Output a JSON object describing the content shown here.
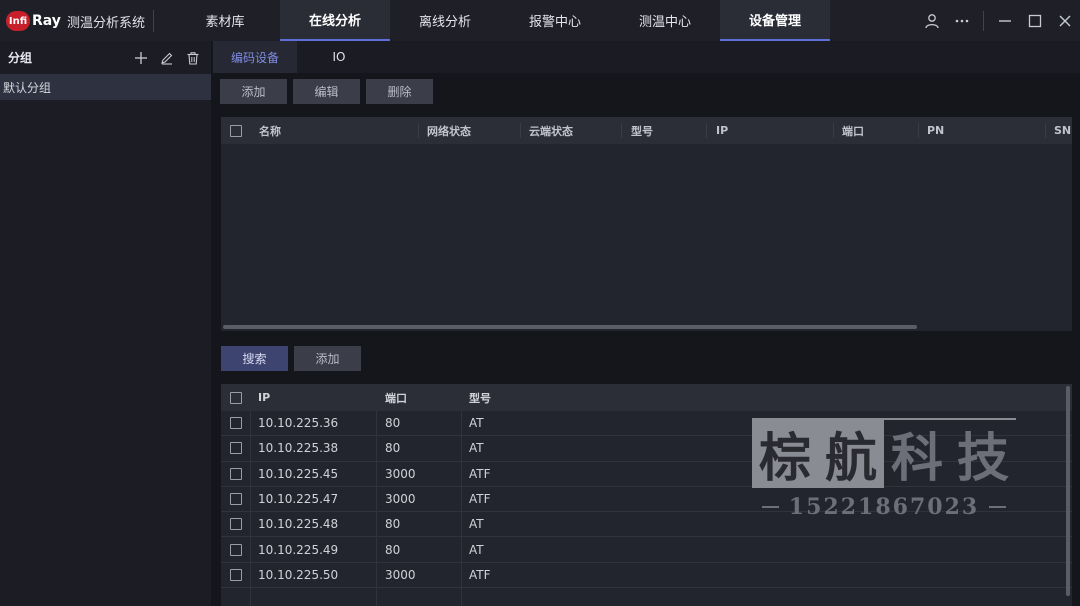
{
  "header": {
    "logo_mark": "Infi",
    "logo_text": "Ray",
    "app_name": "测温分析系统",
    "tabs": [
      {
        "label": "素材库",
        "active": false
      },
      {
        "label": "在线分析",
        "active": true
      },
      {
        "label": "离线分析",
        "active": false
      },
      {
        "label": "报警中心",
        "active": false
      },
      {
        "label": "测温中心",
        "active": false
      },
      {
        "label": "设备管理",
        "active": true
      }
    ]
  },
  "sidebar": {
    "title": "分组",
    "groups": [
      "默认分组"
    ]
  },
  "main": {
    "subtabs": [
      "编码设备",
      "IO"
    ],
    "toolbar": {
      "add": "添加",
      "edit": "编辑",
      "delete": "删除"
    },
    "device_table": {
      "columns": [
        "名称",
        "网络状态",
        "云端状态",
        "型号",
        "IP",
        "端口",
        "PN",
        "SN"
      ]
    },
    "search_toolbar": {
      "search": "搜索",
      "add": "添加"
    },
    "result_table": {
      "columns": [
        "IP",
        "端口",
        "型号"
      ],
      "rows": [
        [
          "10.10.225.36",
          "80",
          "AT"
        ],
        [
          "10.10.225.38",
          "80",
          "AT"
        ],
        [
          "10.10.225.45",
          "3000",
          "ATF"
        ],
        [
          "10.10.225.47",
          "3000",
          "ATF"
        ],
        [
          "10.10.225.48",
          "80",
          "AT"
        ],
        [
          "10.10.225.49",
          "80",
          "AT"
        ],
        [
          "10.10.225.50",
          "3000",
          "ATF"
        ]
      ]
    }
  },
  "watermark": {
    "title": "棕航科技",
    "phone": "15221867023"
  },
  "colors": {
    "accent": "#5d6fd8",
    "logo_red": "#c8202a"
  }
}
